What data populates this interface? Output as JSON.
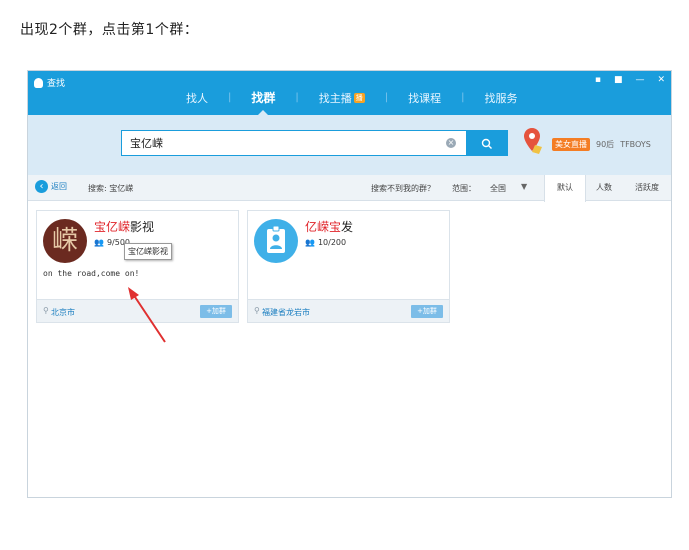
{
  "caption": "出现2个群，点击第1个群：",
  "app": {
    "title": "查找",
    "tabs": [
      {
        "label": "找人",
        "active": false
      },
      {
        "label": "找群",
        "active": true
      },
      {
        "label": "找主播",
        "active": false,
        "badge": "播"
      },
      {
        "label": "找课程",
        "active": false
      },
      {
        "label": "找服务",
        "active": false
      }
    ],
    "window_controls": [
      "feedback-icon",
      "skin-icon",
      "minimize-icon",
      "close-icon"
    ]
  },
  "search": {
    "value": "宝亿嵘",
    "button_icon": "search-icon",
    "hot_badge": "美女直播",
    "hot_tags": [
      "90后",
      "TFBOYS"
    ]
  },
  "toolbar": {
    "back_label": "返回",
    "search_label": "搜索: 宝亿嵘",
    "not_found": "搜索不到我的群？",
    "range_label": "范围：",
    "range_value": "全国",
    "sort_tabs": [
      {
        "label": "默认",
        "active": true
      },
      {
        "label": "人数",
        "active": false
      },
      {
        "label": "活跃度",
        "active": false
      }
    ]
  },
  "results": [
    {
      "name_highlight": "宝亿嵘",
      "name_rest": "影视",
      "members": "9/500",
      "description": "on the road,come on!",
      "location": "北京市",
      "join_label": "+加群",
      "avatar_char": "嵘",
      "tooltip": "宝亿嵘影视"
    },
    {
      "name_highlight": "亿嵘宝",
      "name_rest": "发",
      "members": "10/200",
      "description": "",
      "location": "福建省龙岩市",
      "join_label": "+加群",
      "avatar_char": ""
    }
  ],
  "colors": {
    "accent": "#1a9ddc",
    "highlight": "#e0252b",
    "annotation_arrow": "#e03030"
  }
}
